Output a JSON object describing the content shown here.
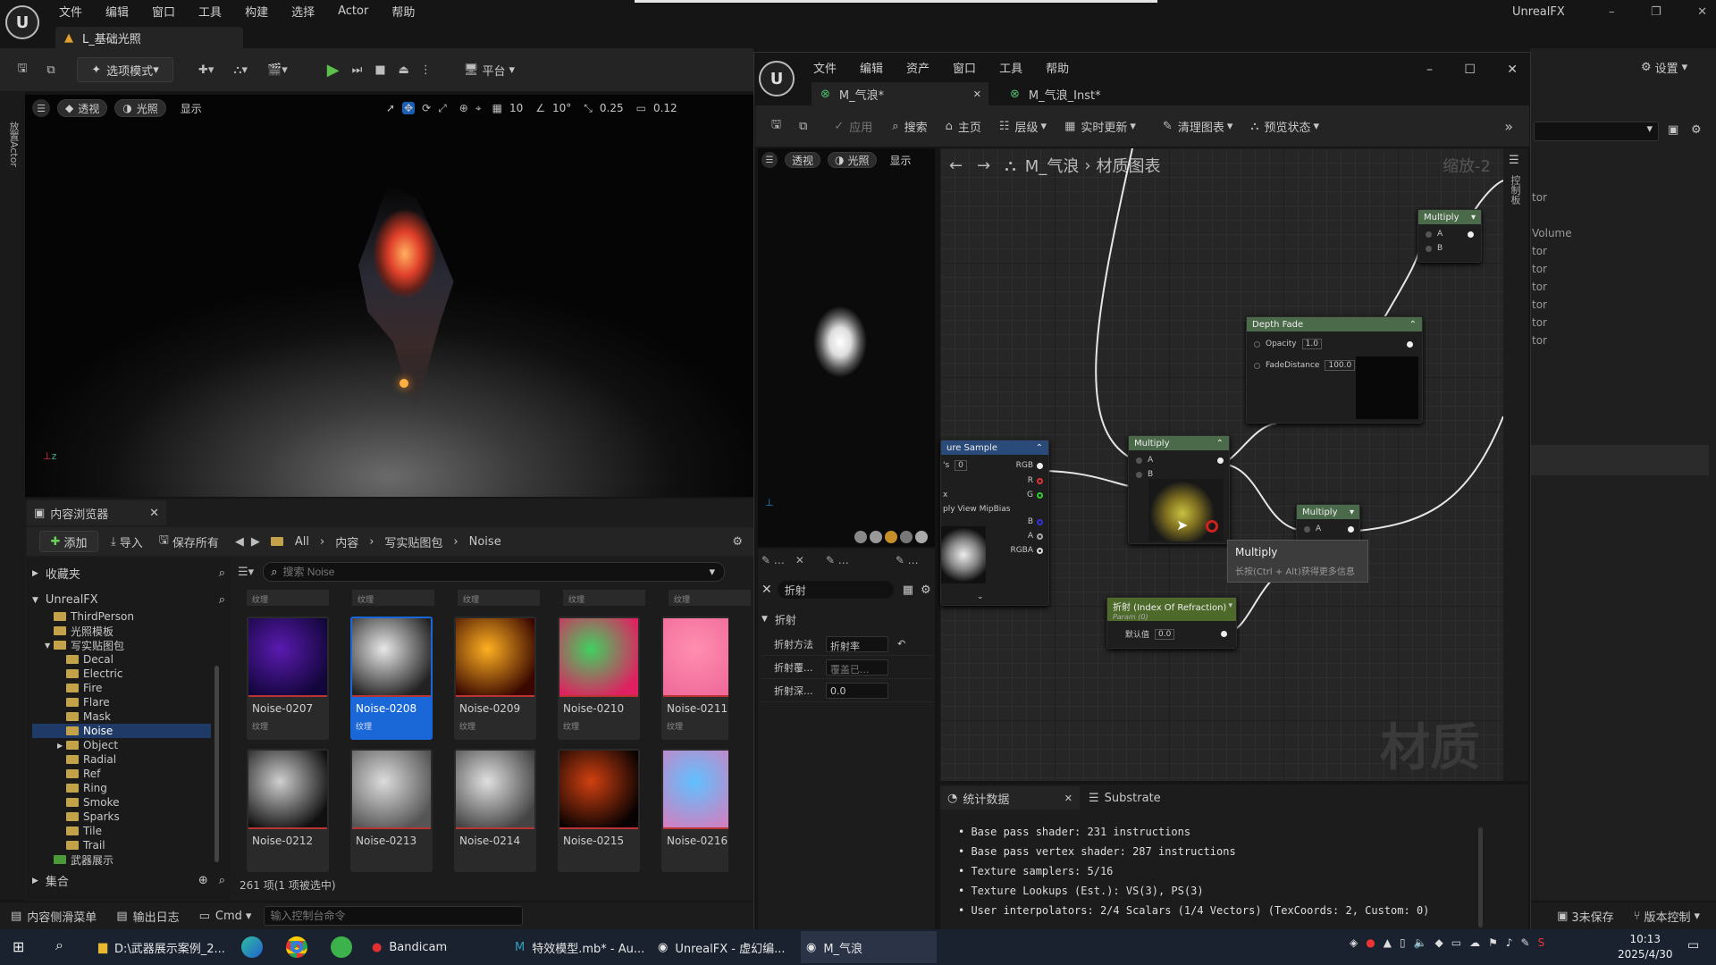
{
  "main_window": {
    "menu": [
      "文件",
      "编辑",
      "窗口",
      "工具",
      "构建",
      "选择",
      "Actor",
      "帮助"
    ],
    "app_name": "UnrealFX",
    "level_tab": "L_基础光照"
  },
  "toolbar": {
    "mode": "选项模式",
    "platform": "平台",
    "settings": "设置"
  },
  "viewport": {
    "perspective": "透视",
    "lighting": "光照",
    "show": "显示",
    "grid": "10",
    "angle": "10°",
    "scale": "0.25",
    "camera_speed": "0.12"
  },
  "left_strip": "放置Actor",
  "content_browser": {
    "tab": "内容浏览器",
    "add": "添加",
    "import": "导入",
    "save_all": "保存所有",
    "path": [
      "All",
      "内容",
      "写实贴图包",
      "Noise"
    ],
    "favorites": "收藏夹",
    "root": "UnrealFX",
    "search_placeholder": "搜索 Noise",
    "collections": "集合",
    "count": "261 项(1 项被选中)",
    "tree": [
      {
        "label": "ThirdPerson",
        "indent": 1
      },
      {
        "label": "光照模板",
        "indent": 1
      },
      {
        "label": "写实贴图包",
        "indent": 1,
        "open": true
      },
      {
        "label": "Decal",
        "indent": 2
      },
      {
        "label": "Electric",
        "indent": 2
      },
      {
        "label": "Fire",
        "indent": 2
      },
      {
        "label": "Flare",
        "indent": 2
      },
      {
        "label": "Mask",
        "indent": 2
      },
      {
        "label": "Noise",
        "indent": 2,
        "selected": true
      },
      {
        "label": "Object",
        "indent": 2
      },
      {
        "label": "Radial",
        "indent": 2
      },
      {
        "label": "Ref",
        "indent": 2
      },
      {
        "label": "Ring",
        "indent": 2
      },
      {
        "label": "Smoke",
        "indent": 2
      },
      {
        "label": "Sparks",
        "indent": 2
      },
      {
        "label": "Tile",
        "indent": 2
      },
      {
        "label": "Trail",
        "indent": 2
      },
      {
        "label": "武器展示",
        "indent": 1
      }
    ],
    "assets_top_type": "纹理",
    "assets": [
      {
        "name": "Noise-0207",
        "type": "纹理",
        "colors": [
          "#5a1ab0",
          "#12063a"
        ]
      },
      {
        "name": "Noise-0208",
        "type": "纹理",
        "colors": [
          "#e8e8e8",
          "#222"
        ],
        "selected": true
      },
      {
        "name": "Noise-0209",
        "type": "纹理",
        "colors": [
          "#ffb020",
          "#3a0800"
        ]
      },
      {
        "name": "Noise-0210",
        "type": "纹理",
        "colors": [
          "#40d060",
          "#e02060"
        ]
      },
      {
        "name": "Noise-0211",
        "type": "纹理",
        "colors": [
          "#ff8fb0",
          "#f06a9a"
        ]
      },
      {
        "name": "Noise-0212",
        "type": "",
        "colors": [
          "#cfcfcf",
          "#111"
        ]
      },
      {
        "name": "Noise-0213",
        "type": "",
        "colors": [
          "#dcdcdc",
          "#555"
        ]
      },
      {
        "name": "Noise-0214",
        "type": "",
        "colors": [
          "#e0e0e0",
          "#444"
        ]
      },
      {
        "name": "Noise-0215",
        "type": "",
        "colors": [
          "#d04010",
          "#080202"
        ]
      },
      {
        "name": "Noise-0216",
        "type": "",
        "colors": [
          "#60c0ff",
          "#d080c0"
        ]
      }
    ]
  },
  "bottom_bar": {
    "drawer": "内容侧滑菜单",
    "output_log": "输出日志",
    "cmd": "Cmd",
    "console_placeholder": "输入控制台命令",
    "unsaved": "3未保存",
    "source_control": "版本控制"
  },
  "material_editor": {
    "menu": [
      "文件",
      "编辑",
      "资产",
      "窗口",
      "工具",
      "帮助"
    ],
    "tab_active": "M_气浪*",
    "tab_inactive": "M_气浪_Inst*",
    "toolbar": [
      "应用",
      "搜索",
      "主页",
      "层级",
      "实时更新",
      "清理图表",
      "预览状态"
    ],
    "preview": {
      "perspective": "透视",
      "lighting": "光照",
      "show": "显示"
    },
    "breadcrumb": [
      "M_气浪",
      "材质图表"
    ],
    "zoom": "缩放-2",
    "watermark": "材质",
    "side_label": "控制板",
    "details": {
      "search": "折射",
      "section": "折射",
      "rows": [
        {
          "label": "折射方法",
          "value": "折射率"
        },
        {
          "label": "折射覆...",
          "value": "覆盖已..."
        },
        {
          "label": "折射深...",
          "value": "0.0"
        }
      ]
    },
    "nodes": {
      "multiply": "Multiply",
      "depth_fade": "Depth Fade",
      "opacity_label": "Opacity",
      "opacity": "1.0",
      "fade_label": "FadeDistance",
      "fade": "100.0",
      "texture_sample": "ure Sample",
      "uvs": "0",
      "mip": "ply View MipBias",
      "ior_title": "折射 (Index Of Refraction)",
      "ior_sub": "Param (0)",
      "ior_default_label": "默认值",
      "ior_value": "0.0",
      "pins": [
        "RGB",
        "R",
        "G",
        "B",
        "A",
        "RGBA"
      ],
      "a": "A",
      "b": "B",
      "x": "x"
    },
    "tooltip": {
      "title": "Multiply",
      "hint": "长按(Ctrl + Alt)获得更多信息"
    },
    "stats": {
      "tab": "统计数据",
      "tab2": "Substrate",
      "lines": [
        "Base pass shader: 231 instructions",
        "Base pass vertex shader: 287 instructions",
        "Texture samplers: 5/16",
        "Texture Lookups (Est.): VS(3), PS(3)",
        "User interpolators: 2/4 Scalars (1/4 Vectors) (TexCoords: 2, Custom: 0)"
      ]
    }
  },
  "right_panel": {
    "items": [
      "tor",
      "Volume",
      "tor",
      "tor",
      "tor",
      "tor",
      "tor",
      "tor"
    ]
  },
  "taskbar": {
    "items": [
      "D:\\武器展示案例_2...",
      "Bandicam",
      "特效模型.mb* - Au...",
      "UnrealFX - 虚幻编...",
      "M_气浪"
    ],
    "time": "10:13",
    "date": "2025/4/30"
  }
}
